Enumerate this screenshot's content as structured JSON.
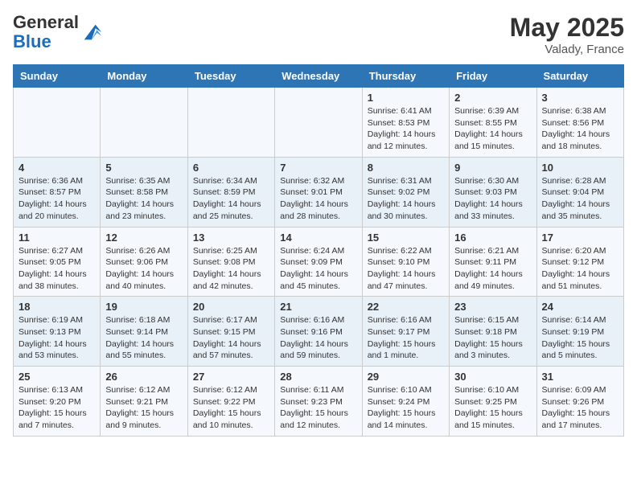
{
  "header": {
    "logo_general": "General",
    "logo_blue": "Blue",
    "month_year": "May 2025",
    "location": "Valady, France"
  },
  "days_of_week": [
    "Sunday",
    "Monday",
    "Tuesday",
    "Wednesday",
    "Thursday",
    "Friday",
    "Saturday"
  ],
  "weeks": [
    [
      {
        "day": "",
        "content": ""
      },
      {
        "day": "",
        "content": ""
      },
      {
        "day": "",
        "content": ""
      },
      {
        "day": "",
        "content": ""
      },
      {
        "day": "1",
        "content": "Sunrise: 6:41 AM\nSunset: 8:53 PM\nDaylight: 14 hours and 12 minutes."
      },
      {
        "day": "2",
        "content": "Sunrise: 6:39 AM\nSunset: 8:55 PM\nDaylight: 14 hours and 15 minutes."
      },
      {
        "day": "3",
        "content": "Sunrise: 6:38 AM\nSunset: 8:56 PM\nDaylight: 14 hours and 18 minutes."
      }
    ],
    [
      {
        "day": "4",
        "content": "Sunrise: 6:36 AM\nSunset: 8:57 PM\nDaylight: 14 hours and 20 minutes."
      },
      {
        "day": "5",
        "content": "Sunrise: 6:35 AM\nSunset: 8:58 PM\nDaylight: 14 hours and 23 minutes."
      },
      {
        "day": "6",
        "content": "Sunrise: 6:34 AM\nSunset: 8:59 PM\nDaylight: 14 hours and 25 minutes."
      },
      {
        "day": "7",
        "content": "Sunrise: 6:32 AM\nSunset: 9:01 PM\nDaylight: 14 hours and 28 minutes."
      },
      {
        "day": "8",
        "content": "Sunrise: 6:31 AM\nSunset: 9:02 PM\nDaylight: 14 hours and 30 minutes."
      },
      {
        "day": "9",
        "content": "Sunrise: 6:30 AM\nSunset: 9:03 PM\nDaylight: 14 hours and 33 minutes."
      },
      {
        "day": "10",
        "content": "Sunrise: 6:28 AM\nSunset: 9:04 PM\nDaylight: 14 hours and 35 minutes."
      }
    ],
    [
      {
        "day": "11",
        "content": "Sunrise: 6:27 AM\nSunset: 9:05 PM\nDaylight: 14 hours and 38 minutes."
      },
      {
        "day": "12",
        "content": "Sunrise: 6:26 AM\nSunset: 9:06 PM\nDaylight: 14 hours and 40 minutes."
      },
      {
        "day": "13",
        "content": "Sunrise: 6:25 AM\nSunset: 9:08 PM\nDaylight: 14 hours and 42 minutes."
      },
      {
        "day": "14",
        "content": "Sunrise: 6:24 AM\nSunset: 9:09 PM\nDaylight: 14 hours and 45 minutes."
      },
      {
        "day": "15",
        "content": "Sunrise: 6:22 AM\nSunset: 9:10 PM\nDaylight: 14 hours and 47 minutes."
      },
      {
        "day": "16",
        "content": "Sunrise: 6:21 AM\nSunset: 9:11 PM\nDaylight: 14 hours and 49 minutes."
      },
      {
        "day": "17",
        "content": "Sunrise: 6:20 AM\nSunset: 9:12 PM\nDaylight: 14 hours and 51 minutes."
      }
    ],
    [
      {
        "day": "18",
        "content": "Sunrise: 6:19 AM\nSunset: 9:13 PM\nDaylight: 14 hours and 53 minutes."
      },
      {
        "day": "19",
        "content": "Sunrise: 6:18 AM\nSunset: 9:14 PM\nDaylight: 14 hours and 55 minutes."
      },
      {
        "day": "20",
        "content": "Sunrise: 6:17 AM\nSunset: 9:15 PM\nDaylight: 14 hours and 57 minutes."
      },
      {
        "day": "21",
        "content": "Sunrise: 6:16 AM\nSunset: 9:16 PM\nDaylight: 14 hours and 59 minutes."
      },
      {
        "day": "22",
        "content": "Sunrise: 6:16 AM\nSunset: 9:17 PM\nDaylight: 15 hours and 1 minute."
      },
      {
        "day": "23",
        "content": "Sunrise: 6:15 AM\nSunset: 9:18 PM\nDaylight: 15 hours and 3 minutes."
      },
      {
        "day": "24",
        "content": "Sunrise: 6:14 AM\nSunset: 9:19 PM\nDaylight: 15 hours and 5 minutes."
      }
    ],
    [
      {
        "day": "25",
        "content": "Sunrise: 6:13 AM\nSunset: 9:20 PM\nDaylight: 15 hours and 7 minutes."
      },
      {
        "day": "26",
        "content": "Sunrise: 6:12 AM\nSunset: 9:21 PM\nDaylight: 15 hours and 9 minutes."
      },
      {
        "day": "27",
        "content": "Sunrise: 6:12 AM\nSunset: 9:22 PM\nDaylight: 15 hours and 10 minutes."
      },
      {
        "day": "28",
        "content": "Sunrise: 6:11 AM\nSunset: 9:23 PM\nDaylight: 15 hours and 12 minutes."
      },
      {
        "day": "29",
        "content": "Sunrise: 6:10 AM\nSunset: 9:24 PM\nDaylight: 15 hours and 14 minutes."
      },
      {
        "day": "30",
        "content": "Sunrise: 6:10 AM\nSunset: 9:25 PM\nDaylight: 15 hours and 15 minutes."
      },
      {
        "day": "31",
        "content": "Sunrise: 6:09 AM\nSunset: 9:26 PM\nDaylight: 15 hours and 17 minutes."
      }
    ]
  ]
}
